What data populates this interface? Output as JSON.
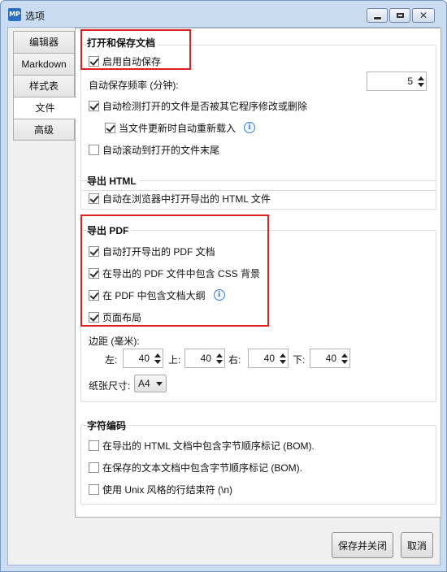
{
  "window": {
    "icon_text": "MP",
    "title": "选项"
  },
  "tabs": [
    {
      "label": "编辑器",
      "active": false
    },
    {
      "label": "Markdown",
      "active": false
    },
    {
      "label": "样式表",
      "active": false
    },
    {
      "label": "文件",
      "active": true
    },
    {
      "label": "高级",
      "active": false
    }
  ],
  "open_save": {
    "title": "打开和保存文档",
    "enable_autosave": {
      "label": "启用自动保存",
      "checked": true
    },
    "autosave_freq_label": "自动保存频率 (分钟):",
    "autosave_freq_value": "5",
    "detect_changes": {
      "label": "自动检测打开的文件是否被其它程序修改或删除",
      "checked": true
    },
    "auto_reload": {
      "label": "当文件更新时自动重新载入",
      "checked": true
    },
    "scroll_to_end": {
      "label": "自动滚动到打开的文件末尾",
      "checked": false
    }
  },
  "export_html": {
    "title": "导出 HTML",
    "open_in_browser": {
      "label": "自动在浏览器中打开导出的 HTML 文件",
      "checked": true
    }
  },
  "export_pdf": {
    "title": "导出 PDF",
    "auto_open": {
      "label": "自动打开导出的 PDF 文档",
      "checked": true
    },
    "include_css": {
      "label": "在导出的 PDF 文件中包含 CSS 背景",
      "checked": true
    },
    "include_outline": {
      "label": "在 PDF 中包含文档大纲",
      "checked": true
    },
    "page_layout": {
      "label": "页面布局",
      "checked": true
    },
    "margins_label": "边距 (毫米):",
    "margin_left_label": "左:",
    "margin_left": "40",
    "margin_top_label": "上:",
    "margin_top": "40",
    "margin_right_label": "右:",
    "margin_right": "40",
    "margin_bottom_label": "下:",
    "margin_bottom": "40",
    "paper_size_label": "纸张尺寸:",
    "paper_size": "A4"
  },
  "encoding": {
    "title": "字符编码",
    "bom_html": {
      "label": "在导出的 HTML 文档中包含字节顺序标记 (BOM).",
      "checked": false
    },
    "bom_text": {
      "label": "在保存的文本文档中包含字节顺序标记 (BOM).",
      "checked": false
    },
    "unix_eol": {
      "label": "使用 Unix 风格的行结束符 (\\n)",
      "checked": false
    }
  },
  "buttons": {
    "save_close": "保存并关闭",
    "cancel": "取消"
  },
  "colors": {
    "highlight_box": "#e02020",
    "title_bar": "#c9dcf2"
  }
}
